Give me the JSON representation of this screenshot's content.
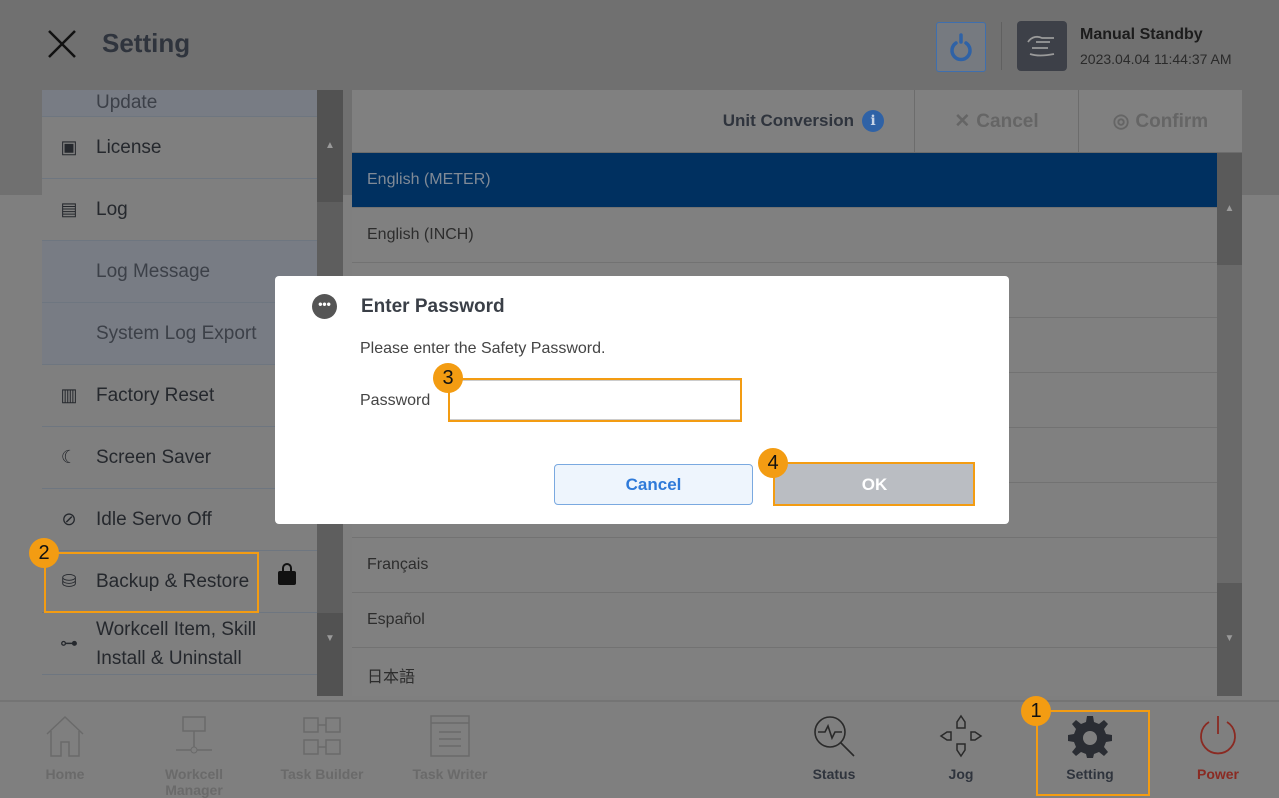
{
  "header": {
    "title": "Setting",
    "mode": "Manual Standby",
    "datetime": "2023.04.04 11:44:37 AM"
  },
  "sidebar": {
    "items": [
      {
        "label": "Update",
        "icon": "update-icon",
        "sub": false
      },
      {
        "label": "License",
        "icon": "license-icon",
        "sub": false
      },
      {
        "label": "Log",
        "icon": "log-icon",
        "sub": false
      },
      {
        "label": "Log Message",
        "sub": true
      },
      {
        "label": "System Log Export",
        "sub": true
      },
      {
        "label": "Factory Reset",
        "icon": "factory-icon",
        "sub": false
      },
      {
        "label": "Screen Saver",
        "icon": "moon-star-icon",
        "sub": false
      },
      {
        "label": "Idle Servo Off",
        "icon": "servo-off-icon",
        "sub": false
      },
      {
        "label": "Backup & Restore",
        "icon": "database-restore-icon",
        "locked": true
      },
      {
        "label": "Workcell Item, Skill Install & Uninstall",
        "icon": "workcell-icon",
        "sub": false
      }
    ]
  },
  "toolbar": {
    "unit_conversion": "Unit Conversion",
    "cancel": "Cancel",
    "confirm": "Confirm"
  },
  "languages": [
    "English (METER)",
    "English (INCH)",
    "",
    "",
    "",
    "",
    "",
    "Français",
    "Español",
    "日本語"
  ],
  "selected_language": "English (METER)",
  "dialog": {
    "title": "Enter Password",
    "message": "Please enter the Safety Password.",
    "password_label": "Password",
    "password_value": "",
    "cancel": "Cancel",
    "ok": "OK"
  },
  "bottom_nav": [
    {
      "label": "Home",
      "enabled": false
    },
    {
      "label": "Workcell Manager",
      "enabled": false
    },
    {
      "label": "Task Builder",
      "enabled": false
    },
    {
      "label": "Task Writer",
      "enabled": false
    },
    {
      "label": "Status",
      "enabled": true
    },
    {
      "label": "Jog",
      "enabled": true
    },
    {
      "label": "Setting",
      "enabled": true,
      "active": true
    },
    {
      "label": "Power",
      "enabled": true
    }
  ],
  "annotations": [
    "1",
    "2",
    "3",
    "4"
  ],
  "colors": {
    "accent": "#f39c12",
    "selected_row": "#003060",
    "power": "#8a2a22",
    "primary": "#2f7ad9"
  }
}
